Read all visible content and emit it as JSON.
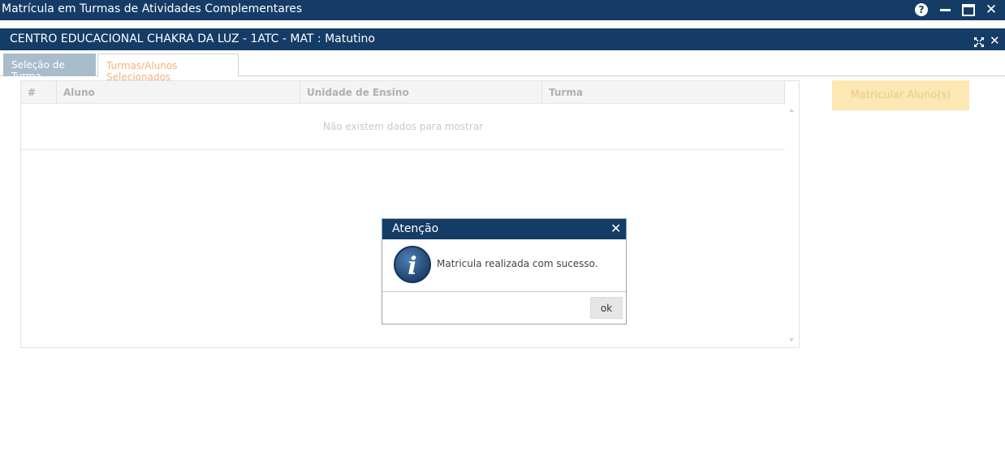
{
  "window": {
    "title": "Matrícula em Turmas de Atividades Complementares",
    "help_glyph": "?",
    "close_glyph": "✕"
  },
  "panel": {
    "title": "CENTRO EDUCACIONAL CHAKRA DA LUZ - 1ATC - MAT : Matutino",
    "close_glyph": "✕"
  },
  "tabs": [
    {
      "label": "Seleção de Turma",
      "active": false
    },
    {
      "label": "Turmas/Alunos Selecionados",
      "active": true
    }
  ],
  "grid": {
    "columns": [
      "#",
      "Aluno",
      "Unidade de Ensino",
      "Turma"
    ],
    "empty_message": "Não existem dados para mostrar"
  },
  "actions": {
    "matricular_label": "Matricular Aluno(s)"
  },
  "dialog": {
    "title": "Atenção",
    "close_glyph": "✕",
    "message": "Matricula realizada com sucesso.",
    "ok_label": "ok",
    "icon": "info-icon",
    "info_glyph": "i"
  },
  "colors": {
    "header_bg": "#143c66",
    "tab_inactive_bg": "#a8bccb",
    "tab_active_text": "#f5b27a",
    "action_button_bg": "#fde7b3"
  }
}
